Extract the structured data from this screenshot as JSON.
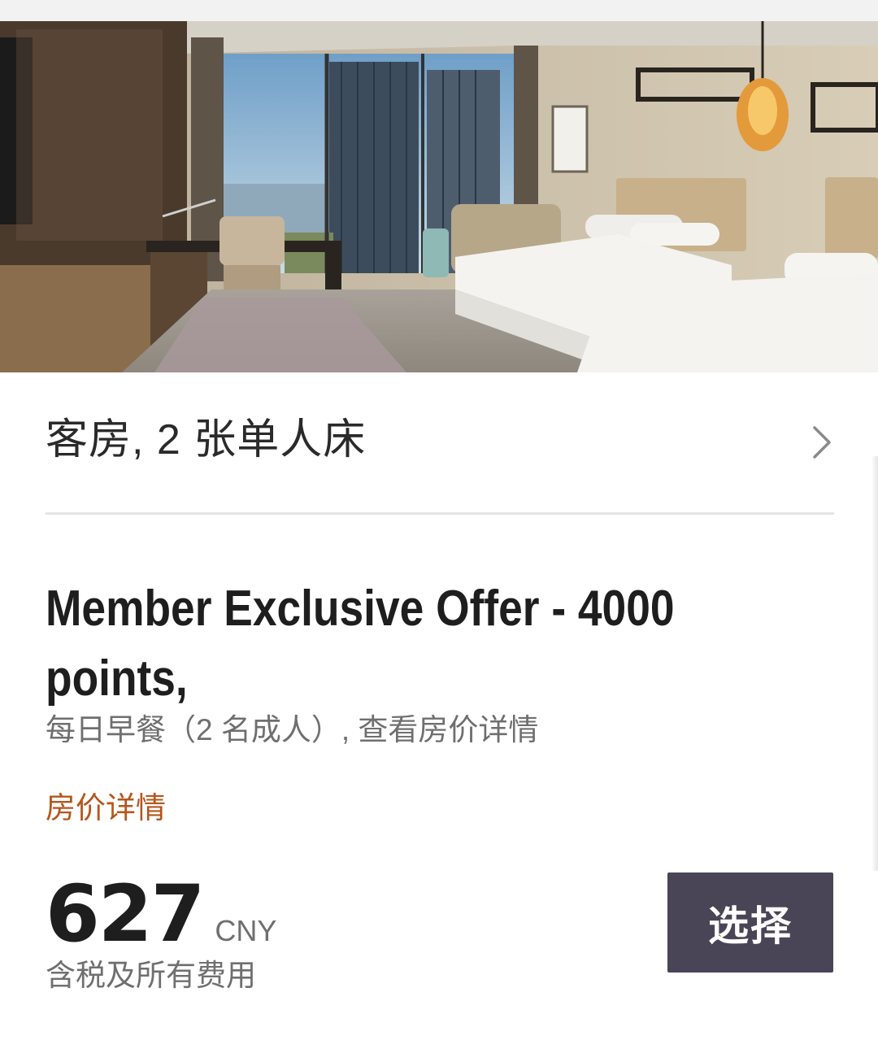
{
  "room": {
    "title": "客房, 2 张单人床",
    "photo_alt": "room-photo"
  },
  "offer": {
    "title": "Member Exclusive Offer - 4000 points,",
    "subtitle": "每日早餐（2 名成人）, 查看房价详情",
    "rate_details_link": "房价详情"
  },
  "price": {
    "amount": "627",
    "currency": "CNY",
    "note": "含税及所有费用"
  },
  "actions": {
    "select_label": "选择"
  },
  "icons": {
    "chevron": "chevron-right-icon"
  },
  "colors": {
    "button_bg": "#4a4556",
    "link": "#b5561c",
    "title": "#1e1e1e",
    "muted": "#6f6f6f"
  }
}
